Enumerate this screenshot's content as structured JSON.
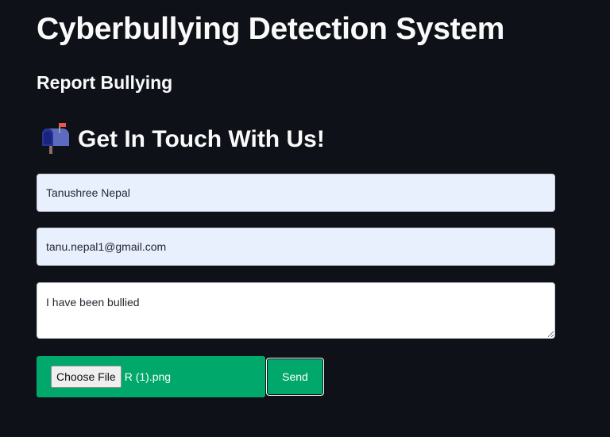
{
  "app_title": "Cyberbullying Detection System",
  "section_title": "Report Bullying",
  "contact": {
    "icon": "mailbox-icon",
    "title": "Get In Touch With Us!"
  },
  "form": {
    "name_value": "Tanushree Nepal",
    "email_value": "tanu.nepal1@gmail.com",
    "message_value": "I have been bullied",
    "choose_file_label": "Choose File",
    "file_name": "R (1).png",
    "send_label": "Send"
  },
  "colors": {
    "background": "#0e1117",
    "accent_green": "#00a86b",
    "autofill_blue": "#e8f0fe",
    "text_light": "#fafafa"
  }
}
